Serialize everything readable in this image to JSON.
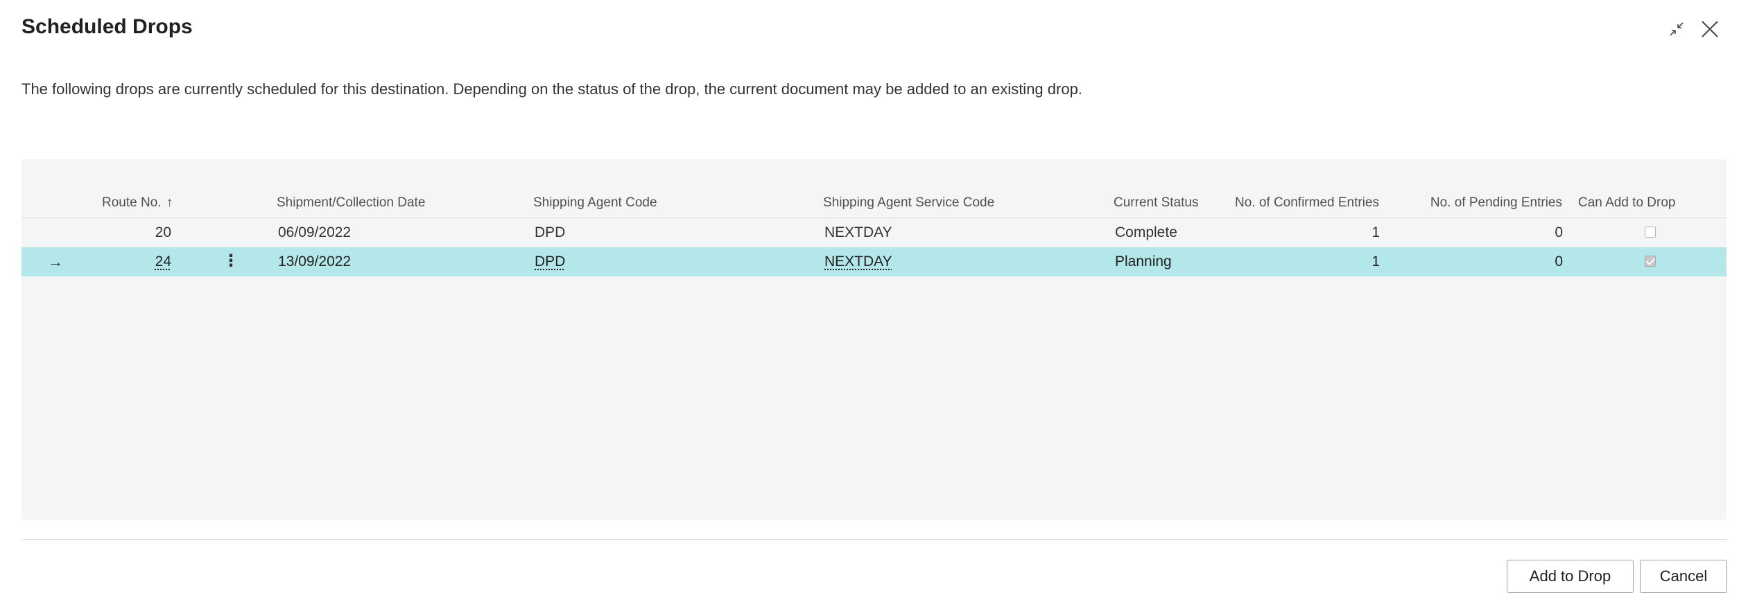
{
  "dialog": {
    "title": "Scheduled Drops",
    "description": "The following drops are currently scheduled for this destination. Depending on the status of the drop, the current document may be added to an existing drop.",
    "collapse_icon": "collapse-arrows-icon",
    "close_icon": "close-icon"
  },
  "grid": {
    "columns": {
      "route_no": "Route No.",
      "sort_indicator": "↑",
      "date": "Shipment/Collection Date",
      "agent_code": "Shipping Agent Code",
      "service_code": "Shipping Agent Service Code",
      "status": "Current Status",
      "confirmed": "No. of Confirmed Entries",
      "pending": "No. of Pending Entries",
      "can_add": "Can Add to Drop"
    },
    "rows": [
      {
        "route_no": "20",
        "date": "06/09/2022",
        "agent_code": "DPD",
        "service_code": "NEXTDAY",
        "status": "Complete",
        "confirmed": "1",
        "pending": "0",
        "can_add": false,
        "selected": false
      },
      {
        "route_no": "24",
        "date": "13/09/2022",
        "agent_code": "DPD",
        "service_code": "NEXTDAY",
        "status": "Planning",
        "confirmed": "1",
        "pending": "0",
        "can_add": true,
        "selected": true,
        "row_marker": "→",
        "menu_glyph": "⋮"
      }
    ],
    "selected_row_color": "#b3e7ea",
    "background_color": "#f4f5f7"
  },
  "actions": {
    "add_to_drop": "Add to Drop",
    "cancel": "Cancel"
  }
}
